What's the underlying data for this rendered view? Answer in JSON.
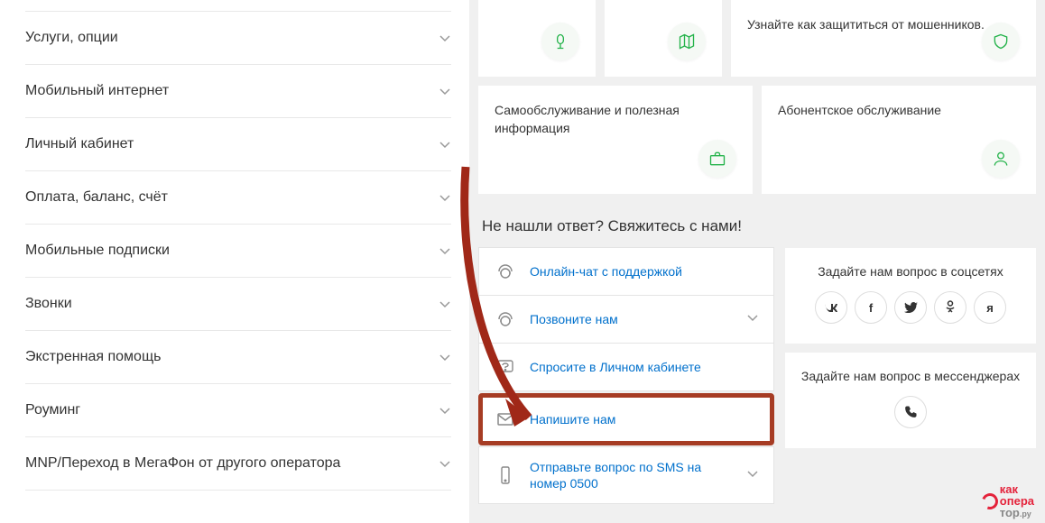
{
  "sidebar": {
    "items": [
      {
        "label": "Услуги, опции"
      },
      {
        "label": "Мобильный интернет"
      },
      {
        "label": "Личный кабинет"
      },
      {
        "label": "Оплата, баланс, счёт"
      },
      {
        "label": "Мобильные подписки"
      },
      {
        "label": "Звонки"
      },
      {
        "label": "Экстренная помощь"
      },
      {
        "label": "Роуминг"
      },
      {
        "label": "MNP/Переход в МегаФон от другого оператора"
      }
    ]
  },
  "topCards": {
    "fraud": "Узнайте как защититься от мошенников."
  },
  "secondRow": {
    "selfService": "Самообслуживание и полезная информация",
    "subscriberService": "Абонентское обслуживание"
  },
  "contact": {
    "heading": "Не нашли ответ? Свяжитесь с нами!",
    "items": {
      "chat": "Онлайн-чат с поддержкой",
      "call": "Позвоните нам",
      "lk": "Спросите в Личном кабинете",
      "write": "Напишите нам",
      "sms": "Отправьте вопрос по SMS на номер 0500"
    }
  },
  "social": {
    "title": "Задайте нам вопрос в соцсетях",
    "messTitle": "Задайте нам вопрос в мессенджерах",
    "buttons": [
      "vk",
      "fb",
      "tw",
      "ok",
      "yz"
    ]
  },
  "logo": {
    "l1": "как",
    "l2": "опера",
    "l3": "тор",
    "suf": ".ру"
  }
}
